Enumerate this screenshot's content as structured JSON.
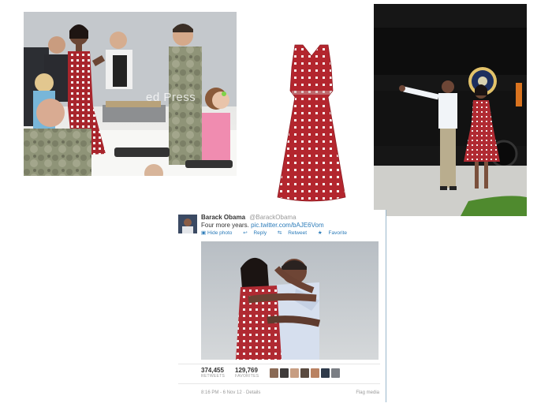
{
  "photo_event": {
    "watermark": "ed Press",
    "description_icon": "photo-icon"
  },
  "photo_dress": {
    "description_icon": "dress-icon"
  },
  "photo_bus": {
    "description_icon": "photo-icon"
  },
  "tweet": {
    "author_name": "Barack Obama",
    "author_handle": "@BarackObama",
    "text_prefix": "Four more years.",
    "text_link": "pic.twitter.com/bAJE6Vom",
    "actions": {
      "hide_photo": "Hide photo",
      "reply": "Reply",
      "retweet": "Retweet",
      "favorite": "Favorite"
    },
    "retweets_count": "374,455",
    "retweets_label": "RETWEETS",
    "favorites_count": "129,769",
    "favorites_label": "FAVORITES",
    "timestamp": "8:16 PM - 6 Nov 12",
    "details": "Details",
    "flag_media": "Flag media",
    "colors": {
      "link": "#2b7bb9",
      "dress_red": "#b3262e"
    }
  }
}
